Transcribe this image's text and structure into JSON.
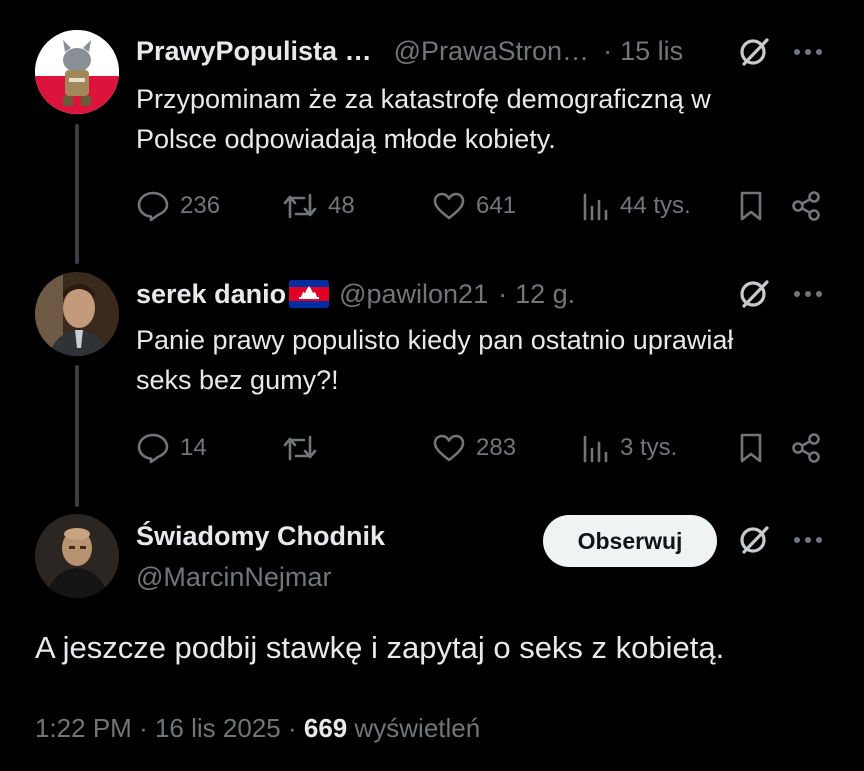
{
  "tweets": [
    {
      "display_name": "PrawyPopulista …",
      "handle": "@PrawaStron…",
      "separator": "·",
      "time": "15 lis",
      "text_lines": [
        "Przypominam że za katastrofę demograficzną w",
        "Polsce odpowiadają młode kobiety."
      ],
      "replies": "236",
      "reposts": "48",
      "likes": "641",
      "views": "44 tys."
    },
    {
      "display_name": "serek danio",
      "handle": "@pawilon21",
      "separator": "·",
      "time": "12 g.",
      "text_lines": [
        "Panie prawy populisto kiedy pan ostatnio uprawiał",
        "seks bez gumy?!"
      ],
      "replies": "14",
      "reposts": "",
      "likes": "283",
      "views": "3 tys."
    }
  ],
  "main_tweet": {
    "display_name": "Świadomy Chodnik",
    "handle": "@MarcinNejmar",
    "follow_label": "Obserwuj",
    "text": "A jeszcze podbij stawkę i zapytaj o seks z kobietą.",
    "time": "1:22 PM",
    "separator": "·",
    "date": "16 lis 2025",
    "views_count": "669",
    "views_label": "wyświetleń"
  },
  "colors": {
    "background": "#000000",
    "text": "#e7e9ea",
    "muted": "#71767b",
    "follow_bg": "#eff3f4",
    "thread_line": "#3c3f43"
  },
  "icons": [
    "reply-icon",
    "repost-icon",
    "like-icon",
    "views-icon",
    "bookmark-icon",
    "share-icon",
    "grok-icon",
    "more-icon",
    "cambodia-flag-icon"
  ]
}
